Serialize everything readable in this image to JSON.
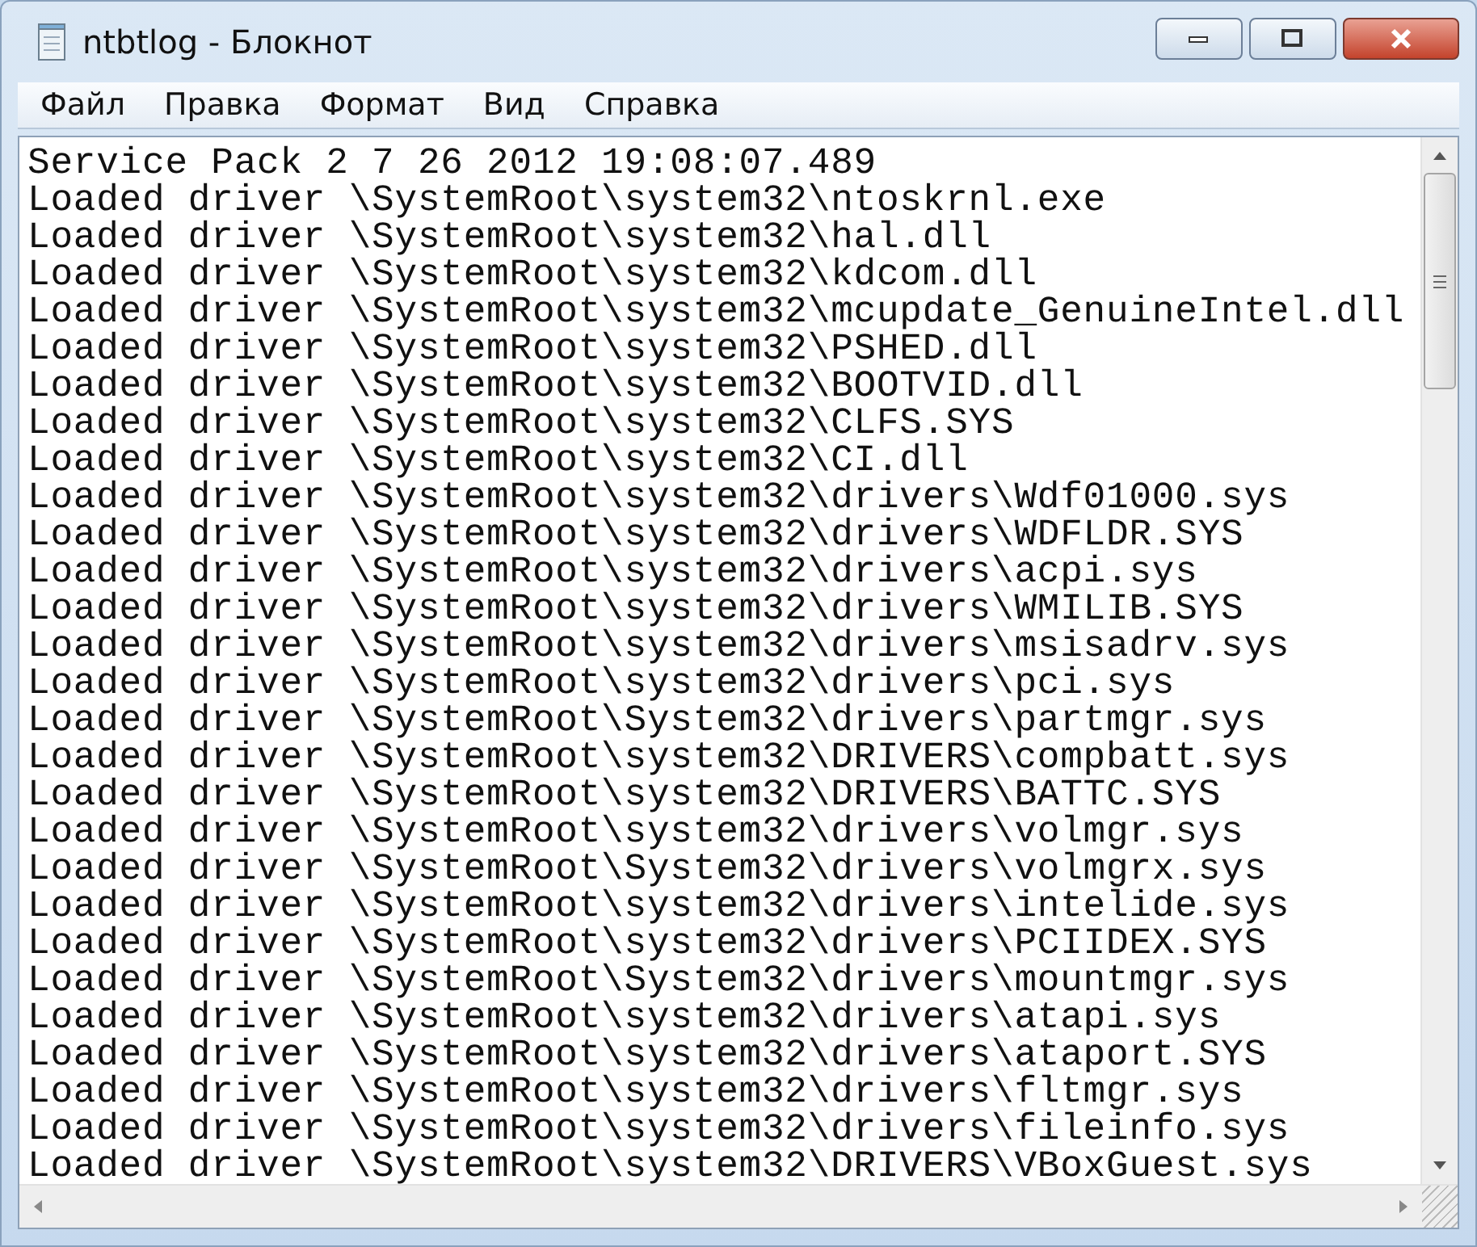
{
  "window": {
    "title": "ntbtlog - Блокнот"
  },
  "menu": [
    "Файл",
    "Правка",
    "Формат",
    "Вид",
    "Справка"
  ],
  "lines": [
    "Service Pack 2 7 26 2012 19:08:07.489",
    "Loaded driver \\SystemRoot\\system32\\ntoskrnl.exe",
    "Loaded driver \\SystemRoot\\system32\\hal.dll",
    "Loaded driver \\SystemRoot\\system32\\kdcom.dll",
    "Loaded driver \\SystemRoot\\system32\\mcupdate_GenuineIntel.dll",
    "Loaded driver \\SystemRoot\\system32\\PSHED.dll",
    "Loaded driver \\SystemRoot\\system32\\BOOTVID.dll",
    "Loaded driver \\SystemRoot\\system32\\CLFS.SYS",
    "Loaded driver \\SystemRoot\\system32\\CI.dll",
    "Loaded driver \\SystemRoot\\system32\\drivers\\Wdf01000.sys",
    "Loaded driver \\SystemRoot\\system32\\drivers\\WDFLDR.SYS",
    "Loaded driver \\SystemRoot\\system32\\drivers\\acpi.sys",
    "Loaded driver \\SystemRoot\\system32\\drivers\\WMILIB.SYS",
    "Loaded driver \\SystemRoot\\system32\\drivers\\msisadrv.sys",
    "Loaded driver \\SystemRoot\\system32\\drivers\\pci.sys",
    "Loaded driver \\SystemRoot\\System32\\drivers\\partmgr.sys",
    "Loaded driver \\SystemRoot\\system32\\DRIVERS\\compbatt.sys",
    "Loaded driver \\SystemRoot\\system32\\DRIVERS\\BATTC.SYS",
    "Loaded driver \\SystemRoot\\system32\\drivers\\volmgr.sys",
    "Loaded driver \\SystemRoot\\System32\\drivers\\volmgrx.sys",
    "Loaded driver \\SystemRoot\\system32\\drivers\\intelide.sys",
    "Loaded driver \\SystemRoot\\system32\\drivers\\PCIIDEX.SYS",
    "Loaded driver \\SystemRoot\\System32\\drivers\\mountmgr.sys",
    "Loaded driver \\SystemRoot\\system32\\drivers\\atapi.sys",
    "Loaded driver \\SystemRoot\\system32\\drivers\\ataport.SYS",
    "Loaded driver \\SystemRoot\\system32\\drivers\\fltmgr.sys",
    "Loaded driver \\SystemRoot\\system32\\drivers\\fileinfo.sys",
    "Loaded driver \\SystemRoot\\system32\\DRIVERS\\VBoxGuest.sys"
  ]
}
